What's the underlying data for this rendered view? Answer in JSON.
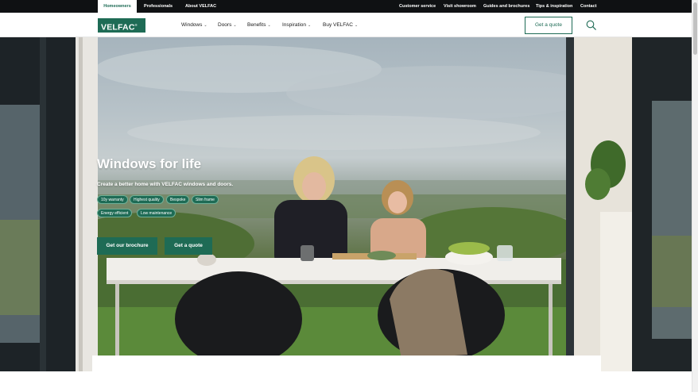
{
  "topbar": {
    "audience_tabs": [
      "Homeowners",
      "Professionals",
      "About VELFAC"
    ],
    "active_tab": "Homeowners",
    "utility_links": [
      "Customer service",
      "Visit showroom",
      "Guides and brochures",
      "Tips & inspiration",
      "Contact"
    ]
  },
  "header": {
    "logo_text": "VELFAC",
    "logo_mark": "®",
    "nav": [
      "Windows",
      "Doors",
      "Benefits",
      "Inspiration",
      "Buy VELFAC"
    ],
    "cta_label": "Get a quote",
    "search_icon": "search-icon"
  },
  "hero": {
    "title": "Windows for life",
    "subtitle": "Create a better home with VELFAC windows and doors.",
    "tags": [
      "10y warranty",
      "Highest quality",
      "Bespoke",
      "Slim frame",
      "Energy efficient",
      "Low maintenance"
    ],
    "buttons": [
      "Get our brochure",
      "Get a quote"
    ]
  },
  "colors": {
    "brand_green": "#1e6b55",
    "topbar_bg": "#0f1113"
  }
}
